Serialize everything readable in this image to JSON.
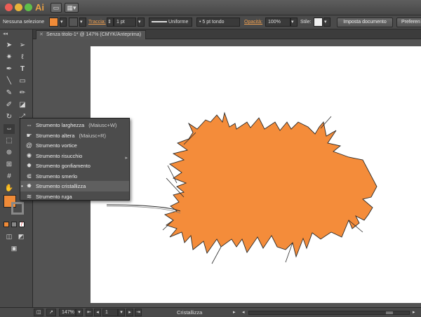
{
  "app": {
    "logo": "Ai"
  },
  "control_bar": {
    "selection_label": "Nessuna selezione",
    "fill_color": "#f08b38",
    "stroke_label": "Traccia:",
    "stroke_width": "1 pt",
    "profile": "Uniforme",
    "brush": "5 pt tondo",
    "opacity_label": "Opacità:",
    "opacity_value": "100%",
    "style_label": "Stile:",
    "doc_setup_button": "Imposta documento",
    "prefs_button": "Preferen"
  },
  "document_tab": {
    "title": "Senza titolo-1* @ 147% (CMYK/Anteprima)"
  },
  "flyout": {
    "items": [
      {
        "label": "Strumento larghezza",
        "shortcut": "(Maiusc+W)",
        "icon": "width-tool-icon"
      },
      {
        "label": "Strumento altera",
        "shortcut": "(Maiusc+R)",
        "icon": "warp-tool-icon"
      },
      {
        "label": "Strumento vortice",
        "shortcut": "",
        "icon": "twirl-tool-icon"
      },
      {
        "label": "Strumento risucchio",
        "shortcut": "",
        "icon": "pucker-tool-icon"
      },
      {
        "label": "Strumento gonfiamento",
        "shortcut": "",
        "icon": "bloat-tool-icon"
      },
      {
        "label": "Strumento smerlo",
        "shortcut": "",
        "icon": "scallop-tool-icon"
      },
      {
        "label": "Strumento cristallizza",
        "shortcut": "",
        "icon": "crystallize-tool-icon"
      },
      {
        "label": "Strumento ruga",
        "shortcut": "",
        "icon": "wrinkle-tool-icon"
      }
    ],
    "selected_index": 6
  },
  "status_bar": {
    "zoom": "147%",
    "page": "1",
    "current_tool": "Cristallizza"
  },
  "colors": {
    "shape_fill": "#f48c3a",
    "accent_orange": "#f08b38",
    "panel": "#4a4a4a"
  }
}
